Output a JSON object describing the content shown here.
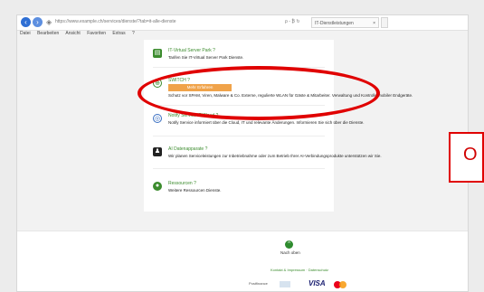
{
  "browser": {
    "address": "https://www.example.ch/services/dienste/?tab=it-alle-dienste",
    "search_text": "ρ - ₿ ↻",
    "tab_title": "IT-Dienstleistungen",
    "tab_close": "×",
    "menu": [
      "Datei",
      "Bearbeiten",
      "Ansicht",
      "Favoriten",
      "Extras",
      "?"
    ]
  },
  "services": [
    {
      "title": "IT-Virtual Server Park ?",
      "desc": "Tarifen Sie IT-Virtual Server Park Dienste."
    },
    {
      "title": "SWITCH ?",
      "button": "Mehr Erfahren",
      "desc": "Schutz vor SPAM, Viren, Malware & Co. Externe, regulierte WLAN für Gäste & Mitarbeiter. Verwaltung und Kontrolle mobiler Endgeräte."
    },
    {
      "title": "Notify Service IT/Cloud ?",
      "desc": "Notify Service informiert über die Cloud, IT und relevante Änderungen. Informieren Sie sich über die Dienste."
    },
    {
      "title": "AI Datenapparate ?",
      "desc": "Wir planen Serviceleistungen zur Inbetriebnahme oder zum Betrieb Ihrer AI-Verbindungsprodukte unterstützen wir Sie."
    },
    {
      "title": "Ressourcen ?",
      "desc": "Weitere Ressourcen Dienste."
    }
  ],
  "footer": {
    "top_icon": "^",
    "top_label": "Nach oben",
    "link": "Kontakt & Impressum · Datenschutz",
    "payments": [
      "Postfinance",
      "Card",
      "VISA",
      "Mastercard"
    ]
  },
  "annotation": {
    "side_letter": "O"
  },
  "colors": {
    "accent_green": "#3c8c2e",
    "orange": "#f0a34a",
    "highlight_red": "#e00000"
  }
}
